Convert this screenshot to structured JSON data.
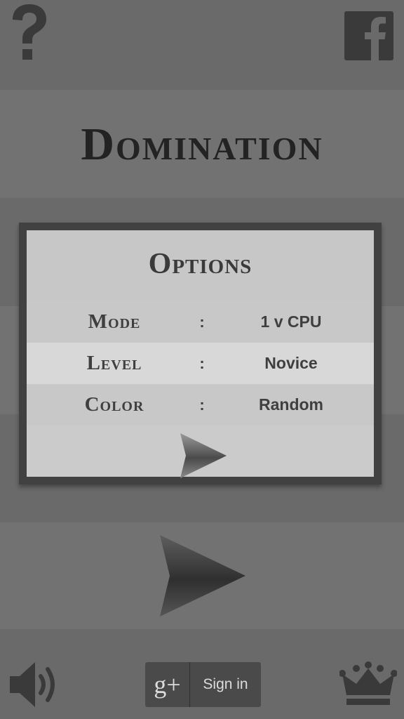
{
  "title": "Domination",
  "options": {
    "heading": "Options",
    "rows": [
      {
        "label": "Mode",
        "separator": ":",
        "value": "1 v CPU"
      },
      {
        "label": "Level",
        "separator": ":",
        "value": "Novice"
      },
      {
        "label": "Color",
        "separator": ":",
        "value": "Random"
      }
    ]
  },
  "signin": {
    "logo": "g+",
    "label": "Sign in"
  },
  "icons": {
    "help": "question-mark-icon",
    "facebook": "facebook-icon",
    "sound": "speaker-icon",
    "leaderboard": "crown-icon",
    "play": "arrow-right-icon"
  },
  "colors": {
    "background_dark": "#6a6a6a",
    "background_light": "#727272",
    "panel": "#cbcbcb",
    "panel_border": "#414141",
    "highlight_row": "#d8d8d8",
    "icon": "#3a3a3a"
  }
}
